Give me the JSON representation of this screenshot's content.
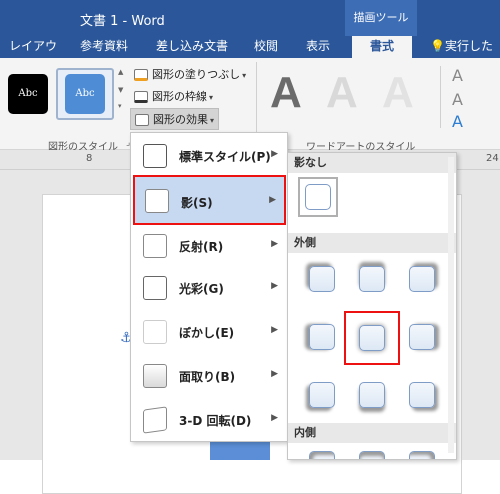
{
  "window": {
    "title": "文書 1 - Word",
    "context_tab_title": "描画ツール"
  },
  "ribbon_tabs": [
    {
      "label": "レイアウト"
    },
    {
      "label": "参考資料"
    },
    {
      "label": "差し込み文書"
    },
    {
      "label": "校閲"
    },
    {
      "label": "表示"
    },
    {
      "label": "書式"
    },
    {
      "label": "実行したい"
    }
  ],
  "shape_styles": {
    "swatch_black": "Abc",
    "swatch_blue": "Abc",
    "fill_label": "図形の塗りつぶし",
    "outline_label": "図形の枠線",
    "effects_label": "図形の効果",
    "group_label": "図形のスタイル"
  },
  "wordart": {
    "letter": "A",
    "group_label": "ワードアートのスタイル"
  },
  "ruler": {
    "mark_left": "8",
    "mark_right": "24"
  },
  "effects_menu": {
    "items": [
      {
        "label": "標準スタイル(P)"
      },
      {
        "label": "影(S)"
      },
      {
        "label": "反射(R)"
      },
      {
        "label": "光彩(G)"
      },
      {
        "label": "ぼかし(E)"
      },
      {
        "label": "面取り(B)"
      },
      {
        "label": "3-D 回転(D)"
      }
    ],
    "selected_index": 1
  },
  "shadow_menu": {
    "section_none": "影なし",
    "section_outer": "外側",
    "section_inner": "内側",
    "outer_selected": "center"
  },
  "colors": {
    "accent": "#2b579a",
    "selection": "#e11111",
    "swatch_blue": "#4e8dd6"
  }
}
